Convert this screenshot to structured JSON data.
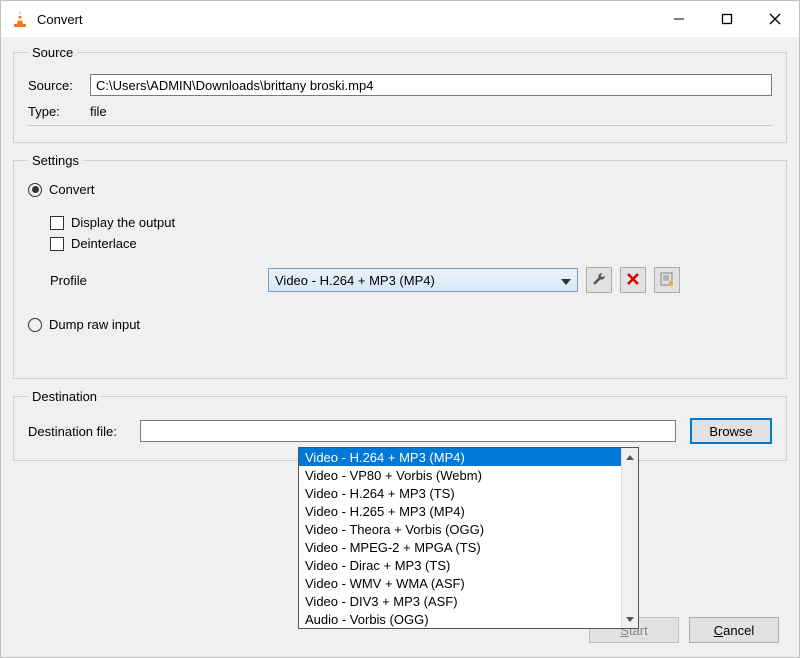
{
  "window": {
    "title": "Convert"
  },
  "source_section": {
    "legend": "Source",
    "source_label": "Source:",
    "source_value": "C:\\Users\\ADMIN\\Downloads\\brittany broski.mp4",
    "type_label": "Type:",
    "type_value": "file"
  },
  "settings_section": {
    "legend": "Settings",
    "convert_label": "Convert",
    "display_output_label": "Display the output",
    "deinterlace_label": "Deinterlace",
    "profile_label": "Profile",
    "profile_selected": "Video - H.264 + MP3 (MP4)",
    "profile_options": [
      "Video - H.264 + MP3 (MP4)",
      "Video - VP80 + Vorbis (Webm)",
      "Video - H.264 + MP3 (TS)",
      "Video - H.265 + MP3 (MP4)",
      "Video - Theora + Vorbis (OGG)",
      "Video - MPEG-2 + MPGA (TS)",
      "Video - Dirac + MP3 (TS)",
      "Video - WMV + WMA (ASF)",
      "Video - DIV3 + MP3 (ASF)",
      "Audio - Vorbis (OGG)"
    ],
    "dump_raw_label": "Dump raw input"
  },
  "destination_section": {
    "legend": "Destination",
    "dest_file_label": "Destination file:",
    "dest_file_value": "",
    "browse_label": "Browse"
  },
  "buttons": {
    "start_label": "Start",
    "cancel_label": "Cancel"
  }
}
